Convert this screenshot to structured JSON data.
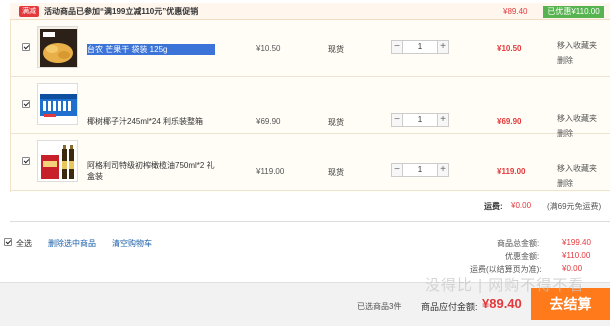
{
  "promo": {
    "tag": "满减",
    "text": "活动商品已参加“满199立减110元”优惠促销",
    "total": "¥89.40",
    "saved": "已优惠¥110.00"
  },
  "items": [
    {
      "name": "台农 芒果干 袋装 125g",
      "price": "¥10.50",
      "stock": "现货",
      "qty": "1",
      "subtotal": "¥10.50",
      "op_fav": "移入收藏夹",
      "op_del": "删除"
    },
    {
      "name": "椰树椰子汁245ml*24 利乐装整箱",
      "price": "¥69.90",
      "stock": "现货",
      "qty": "1",
      "subtotal": "¥69.90",
      "op_fav": "移入收藏夹",
      "op_del": "删除"
    },
    {
      "name": "阿格利司特级初榨橄榄油750ml*2 礼盒装",
      "price": "¥119.00",
      "stock": "现货",
      "qty": "1",
      "subtotal": "¥119.00",
      "op_fav": "移入收藏夹",
      "op_del": "删除"
    }
  ],
  "shipping": {
    "label": "运费:",
    "value": "¥0.00",
    "note": "(满69元免运费)"
  },
  "footer": {
    "select_all": "全选",
    "delete_selected": "删除选中商品",
    "clear_cart": "清空购物车",
    "summary": [
      {
        "label": "商品总金额:",
        "value": "¥199.40"
      },
      {
        "label": "优惠金额:",
        "value": "¥110.00"
      },
      {
        "label": "运费(以结算页为准):",
        "value": "¥0.00"
      }
    ]
  },
  "bottom": {
    "selected_count": "已选商品3件",
    "pay_label": "商品应付金额:",
    "pay_value": "¥89.40",
    "checkout": "去结算"
  },
  "watermark": "没得比 | 网购不得不看",
  "colors": {
    "accent_red": "#e4393c",
    "checkout_orange": "#ff7a1a",
    "saved_green": "#56b34f",
    "link_blue": "#1a5ea8"
  }
}
